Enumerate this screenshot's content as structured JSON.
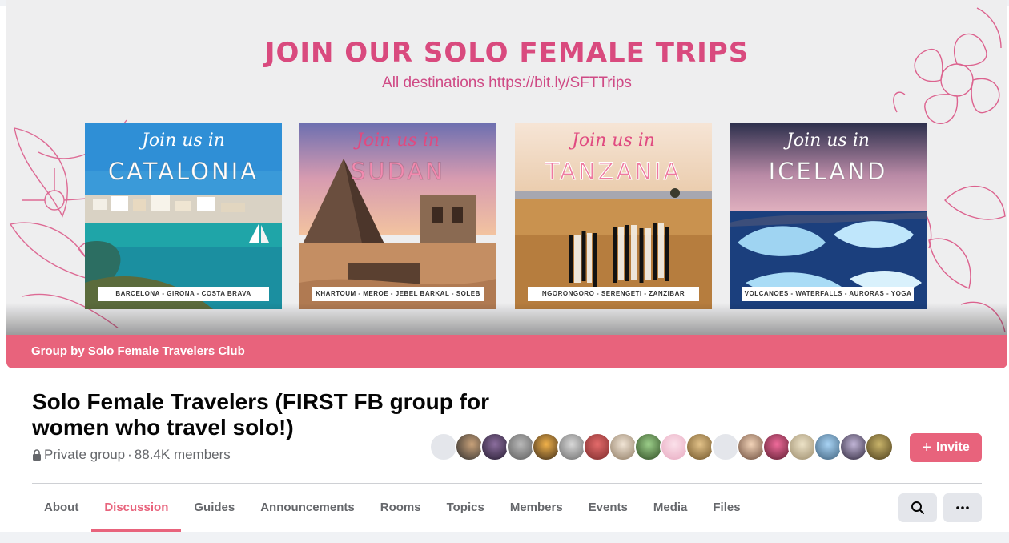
{
  "cover": {
    "headline": "JOIN OUR SOLO FEMALE TRIPS",
    "subline": "All destinations https://bit.ly/SFTTrips",
    "accent_color": "#d94a7e",
    "cards": [
      {
        "join": "Join us in",
        "destination": "CATALONIA",
        "places": "BARCELONA - GIRONA - COSTA BRAVA"
      },
      {
        "join": "Join us in",
        "destination": "SUDAN",
        "places": "KHARTOUM - MEROE - JEBEL BARKAL - SOLEB"
      },
      {
        "join": "Join us in",
        "destination": "TANZANIA",
        "places": "NGORONGORO - SERENGETI - ZANZIBAR"
      },
      {
        "join": "Join us in",
        "destination": "ICELAND",
        "places": "VOLCANOES - WATERFALLS - AURORAS - YOGA"
      }
    ]
  },
  "owner_bar": {
    "text": "Group by Solo Female Travelers Club",
    "color": "#e8637c"
  },
  "group": {
    "title": "Solo Female Travelers (FIRST FB group for women who travel solo!)",
    "privacy": "Private group",
    "separator": "·",
    "members": "88.4K members",
    "member_avatar_count": 18
  },
  "invite_button": {
    "label": "Invite",
    "icon": "plus-icon"
  },
  "tabs": [
    {
      "label": "About",
      "active": false
    },
    {
      "label": "Discussion",
      "active": true
    },
    {
      "label": "Guides",
      "active": false
    },
    {
      "label": "Announcements",
      "active": false
    },
    {
      "label": "Rooms",
      "active": false
    },
    {
      "label": "Topics",
      "active": false
    },
    {
      "label": "Members",
      "active": false
    },
    {
      "label": "Events",
      "active": false
    },
    {
      "label": "Media",
      "active": false
    },
    {
      "label": "Files",
      "active": false
    }
  ],
  "actions": {
    "search_icon": "search-icon",
    "more_icon": "more-options-icon"
  }
}
